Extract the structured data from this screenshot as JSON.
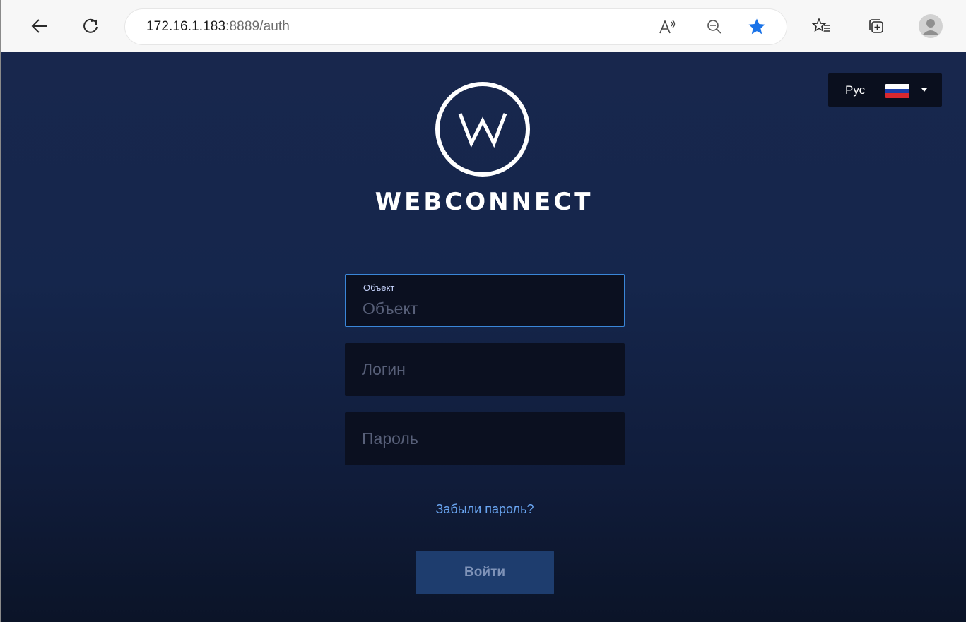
{
  "browser": {
    "url_host": "172.16.1.183",
    "url_rest": ":8889/auth",
    "icons": [
      "back-arrow-icon",
      "refresh-icon",
      "read-aloud-icon",
      "zoom-out-icon",
      "star-filled-icon",
      "favorites-icon",
      "collections-icon",
      "profile-avatar-icon"
    ],
    "star_color": "#1a73e8"
  },
  "language": {
    "label": "Рус",
    "flag_colors": [
      "#ffffff",
      "#1c3fa8",
      "#d7282f"
    ]
  },
  "brand": {
    "logo_letter": "W",
    "name": "WEBCONNECT"
  },
  "form": {
    "object": {
      "label": "Объект",
      "placeholder": "Объект",
      "value": ""
    },
    "login": {
      "placeholder": "Логин",
      "value": ""
    },
    "password": {
      "placeholder": "Пароль",
      "value": ""
    },
    "forgot_link": "Забыли пароль?",
    "submit_label": "Войти"
  },
  "colors": {
    "page_bg": "#15264c",
    "field_bg": "#0b1020",
    "focus_border": "#3a86d8",
    "link": "#6aa6f2",
    "button_bg": "#1e3d6e"
  }
}
